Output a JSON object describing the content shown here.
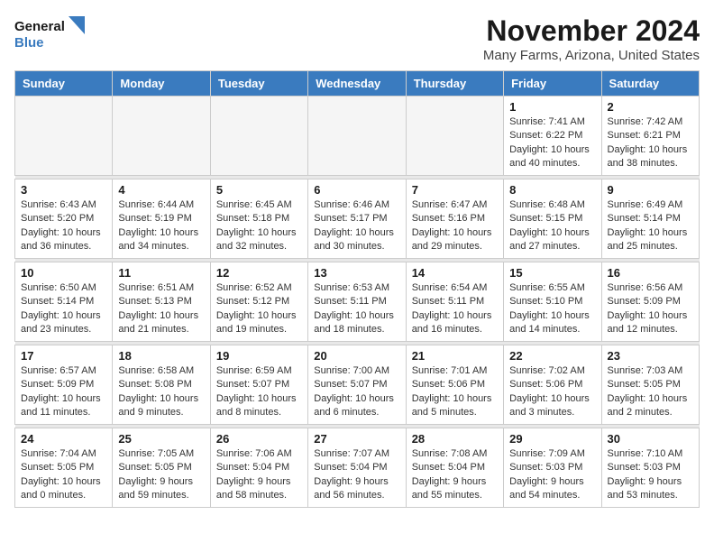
{
  "header": {
    "logo_line1": "General",
    "logo_line2": "Blue",
    "month_title": "November 2024",
    "location": "Many Farms, Arizona, United States"
  },
  "weekdays": [
    "Sunday",
    "Monday",
    "Tuesday",
    "Wednesday",
    "Thursday",
    "Friday",
    "Saturday"
  ],
  "weeks": [
    [
      {
        "day": "",
        "info": ""
      },
      {
        "day": "",
        "info": ""
      },
      {
        "day": "",
        "info": ""
      },
      {
        "day": "",
        "info": ""
      },
      {
        "day": "",
        "info": ""
      },
      {
        "day": "1",
        "info": "Sunrise: 7:41 AM\nSunset: 6:22 PM\nDaylight: 10 hours and 40 minutes."
      },
      {
        "day": "2",
        "info": "Sunrise: 7:42 AM\nSunset: 6:21 PM\nDaylight: 10 hours and 38 minutes."
      }
    ],
    [
      {
        "day": "3",
        "info": "Sunrise: 6:43 AM\nSunset: 5:20 PM\nDaylight: 10 hours and 36 minutes."
      },
      {
        "day": "4",
        "info": "Sunrise: 6:44 AM\nSunset: 5:19 PM\nDaylight: 10 hours and 34 minutes."
      },
      {
        "day": "5",
        "info": "Sunrise: 6:45 AM\nSunset: 5:18 PM\nDaylight: 10 hours and 32 minutes."
      },
      {
        "day": "6",
        "info": "Sunrise: 6:46 AM\nSunset: 5:17 PM\nDaylight: 10 hours and 30 minutes."
      },
      {
        "day": "7",
        "info": "Sunrise: 6:47 AM\nSunset: 5:16 PM\nDaylight: 10 hours and 29 minutes."
      },
      {
        "day": "8",
        "info": "Sunrise: 6:48 AM\nSunset: 5:15 PM\nDaylight: 10 hours and 27 minutes."
      },
      {
        "day": "9",
        "info": "Sunrise: 6:49 AM\nSunset: 5:14 PM\nDaylight: 10 hours and 25 minutes."
      }
    ],
    [
      {
        "day": "10",
        "info": "Sunrise: 6:50 AM\nSunset: 5:14 PM\nDaylight: 10 hours and 23 minutes."
      },
      {
        "day": "11",
        "info": "Sunrise: 6:51 AM\nSunset: 5:13 PM\nDaylight: 10 hours and 21 minutes."
      },
      {
        "day": "12",
        "info": "Sunrise: 6:52 AM\nSunset: 5:12 PM\nDaylight: 10 hours and 19 minutes."
      },
      {
        "day": "13",
        "info": "Sunrise: 6:53 AM\nSunset: 5:11 PM\nDaylight: 10 hours and 18 minutes."
      },
      {
        "day": "14",
        "info": "Sunrise: 6:54 AM\nSunset: 5:11 PM\nDaylight: 10 hours and 16 minutes."
      },
      {
        "day": "15",
        "info": "Sunrise: 6:55 AM\nSunset: 5:10 PM\nDaylight: 10 hours and 14 minutes."
      },
      {
        "day": "16",
        "info": "Sunrise: 6:56 AM\nSunset: 5:09 PM\nDaylight: 10 hours and 12 minutes."
      }
    ],
    [
      {
        "day": "17",
        "info": "Sunrise: 6:57 AM\nSunset: 5:09 PM\nDaylight: 10 hours and 11 minutes."
      },
      {
        "day": "18",
        "info": "Sunrise: 6:58 AM\nSunset: 5:08 PM\nDaylight: 10 hours and 9 minutes."
      },
      {
        "day": "19",
        "info": "Sunrise: 6:59 AM\nSunset: 5:07 PM\nDaylight: 10 hours and 8 minutes."
      },
      {
        "day": "20",
        "info": "Sunrise: 7:00 AM\nSunset: 5:07 PM\nDaylight: 10 hours and 6 minutes."
      },
      {
        "day": "21",
        "info": "Sunrise: 7:01 AM\nSunset: 5:06 PM\nDaylight: 10 hours and 5 minutes."
      },
      {
        "day": "22",
        "info": "Sunrise: 7:02 AM\nSunset: 5:06 PM\nDaylight: 10 hours and 3 minutes."
      },
      {
        "day": "23",
        "info": "Sunrise: 7:03 AM\nSunset: 5:05 PM\nDaylight: 10 hours and 2 minutes."
      }
    ],
    [
      {
        "day": "24",
        "info": "Sunrise: 7:04 AM\nSunset: 5:05 PM\nDaylight: 10 hours and 0 minutes."
      },
      {
        "day": "25",
        "info": "Sunrise: 7:05 AM\nSunset: 5:05 PM\nDaylight: 9 hours and 59 minutes."
      },
      {
        "day": "26",
        "info": "Sunrise: 7:06 AM\nSunset: 5:04 PM\nDaylight: 9 hours and 58 minutes."
      },
      {
        "day": "27",
        "info": "Sunrise: 7:07 AM\nSunset: 5:04 PM\nDaylight: 9 hours and 56 minutes."
      },
      {
        "day": "28",
        "info": "Sunrise: 7:08 AM\nSunset: 5:04 PM\nDaylight: 9 hours and 55 minutes."
      },
      {
        "day": "29",
        "info": "Sunrise: 7:09 AM\nSunset: 5:03 PM\nDaylight: 9 hours and 54 minutes."
      },
      {
        "day": "30",
        "info": "Sunrise: 7:10 AM\nSunset: 5:03 PM\nDaylight: 9 hours and 53 minutes."
      }
    ]
  ]
}
